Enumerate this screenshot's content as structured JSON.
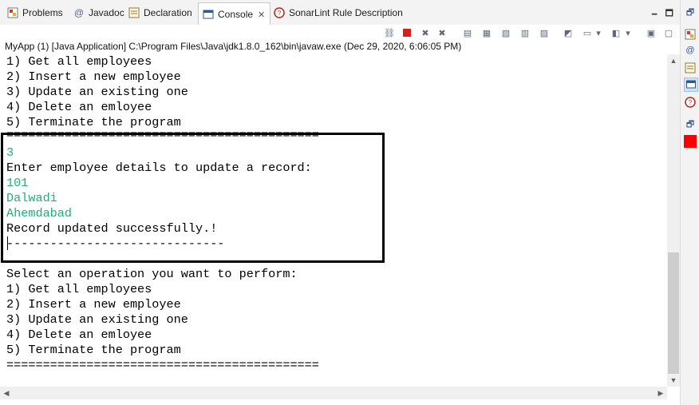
{
  "tabs": [
    {
      "label": "Problems",
      "icon": "problems-icon"
    },
    {
      "label": "Javadoc",
      "icon": "javadoc-icon"
    },
    {
      "label": "Declaration",
      "icon": "declaration-icon"
    },
    {
      "label": "Console",
      "icon": "console-icon",
      "active": true
    },
    {
      "label": "SonarLint Rule Description",
      "icon": "sonarlint-icon"
    }
  ],
  "tab_close_glyph": "✕",
  "launch_info": "MyApp (1) [Java Application] C:\\Program Files\\Java\\jdk1.8.0_162\\bin\\javaw.exe  (Dec 29, 2020, 6:06:05 PM)",
  "console": {
    "lines": [
      {
        "text": "1) Get all employees",
        "type": "output"
      },
      {
        "text": "2) Insert a new employee",
        "type": "output"
      },
      {
        "text": "3) Update an existing one",
        "type": "output"
      },
      {
        "text": "4) Delete an emloyee",
        "type": "output"
      },
      {
        "text": "5) Terminate the program",
        "type": "output"
      },
      {
        "text": "===========================================",
        "type": "output"
      },
      {
        "text": "3",
        "type": "input"
      },
      {
        "text": "Enter employee details to update a record:",
        "type": "output"
      },
      {
        "text": "101",
        "type": "input"
      },
      {
        "text": "Dalwadi",
        "type": "input"
      },
      {
        "text": "Ahemdabad",
        "type": "input"
      },
      {
        "text": "Record updated successfully.!",
        "type": "output"
      },
      {
        "text": "------------------------------",
        "type": "output"
      },
      {
        "text": "",
        "type": "output"
      },
      {
        "text": "Select an operation you want to perform:",
        "type": "output"
      },
      {
        "text": "1) Get all employees",
        "type": "output"
      },
      {
        "text": "2) Insert a new employee",
        "type": "output"
      },
      {
        "text": "3) Update an existing one",
        "type": "output"
      },
      {
        "text": "4) Delete an emloyee",
        "type": "output"
      },
      {
        "text": "5) Terminate the program",
        "type": "output"
      },
      {
        "text": "===========================================",
        "type": "output"
      }
    ]
  },
  "toolbar_icons": [
    "link-icon",
    "terminate-icon",
    "remove-launch-icon",
    "remove-all-terminated-icon",
    "scroll-lock-icon",
    "show-on-stdout-icon",
    "show-on-stderr-icon",
    "word-wrap-icon",
    "clear-console-icon",
    "pin-console-icon",
    "display-selected-console-icon",
    "dropdown-icon",
    "open-console-icon",
    "dropdown-icon",
    "minimize-icon",
    "maximize-icon"
  ],
  "trim_icons": [
    "restore-icon",
    "problems-icon",
    "javadoc-icon",
    "declaration-icon",
    "console-icon",
    "sonarlint-icon",
    "restore-icon",
    "red-marker-icon"
  ],
  "colors": {
    "input_text": "#1fae7a",
    "highlight_border": "#000000",
    "terminate_red": "#d62020"
  }
}
